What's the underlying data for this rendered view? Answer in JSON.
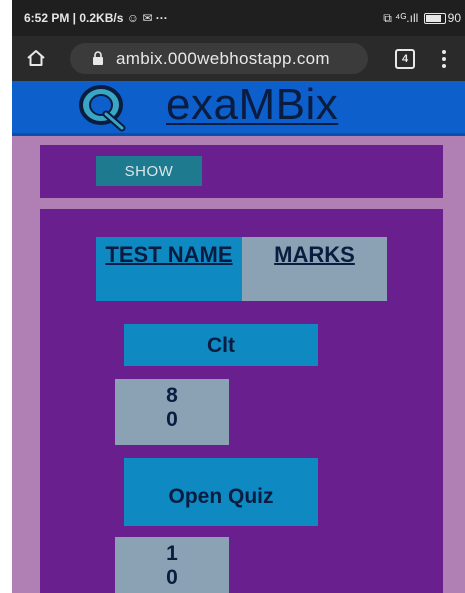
{
  "status_bar": {
    "time_speed": "6:52 PM | 0.2KB/s ☺ ✉ ···",
    "right_info": "⧉ ⁴ᴳ.ıll",
    "battery_level": "90"
  },
  "address_bar": {
    "url": "ambix.000webhostapp.com",
    "tab_count": "4"
  },
  "site": {
    "logo_icon": "q-logo-icon",
    "title": "exaMBix"
  },
  "controls": {
    "show_label": "SHOW"
  },
  "table": {
    "headers": {
      "test_name": "TEST NAME",
      "marks": "MARKS"
    },
    "rows": [
      {
        "name": "Clt",
        "marks": "8 0"
      },
      {
        "name": "Open Quiz",
        "marks": "1 0"
      }
    ]
  },
  "colors": {
    "header_blue": "#0d60cc",
    "panel_purple": "#6a1f8e",
    "page_bg": "#b07fb3",
    "cell_blue": "#0e89c2",
    "cell_grey": "#8aa2b3"
  }
}
